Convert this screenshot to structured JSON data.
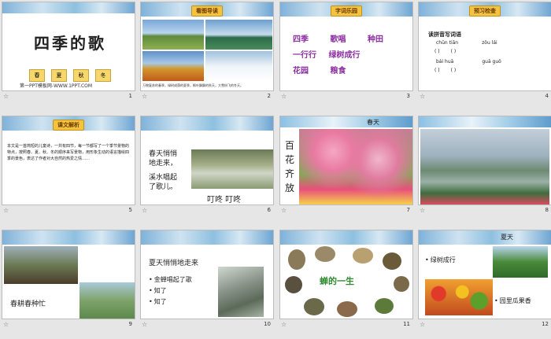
{
  "slides": [
    {
      "num": "1",
      "title": "四季的歌",
      "badges": [
        "春",
        "夏",
        "秋",
        "冬"
      ],
      "footer": "第一PPT模板网-WWW.1PPT.COM"
    },
    {
      "num": "2",
      "tag": "看图导读",
      "caption": "万物复苏的春季，绿树成荫的夏季，枫叶飘飘的秋天，大雪纷飞的冬天。"
    },
    {
      "num": "3",
      "tag": "字词乐园",
      "words": [
        [
          "四季",
          "歌唱",
          "种田"
        ],
        [
          "一行行",
          "绿树成行"
        ],
        [
          "花园",
          "粮食"
        ]
      ]
    },
    {
      "num": "4",
      "tag": "预习检查",
      "instruction": "读拼音写词语",
      "pinyin": [
        [
          "chūn tiān",
          "zǒu lái"
        ],
        [
          "bái huā",
          "guā guǒ"
        ]
      ],
      "blanks": [
        "(          )",
        "(          )"
      ]
    },
    {
      "num": "5",
      "tag": "课文解析",
      "body": "本文是一首简短的儿童诗，一共有四节，每一节都写了一个季节景物的特点，按照春、夏、秋、冬的顺序来写景物，用形象生动的语言描绘四季的景色，表达了作者对大自然的热爱之情……"
    },
    {
      "num": "6",
      "lines": [
        "春天悄悄",
        "地走来，",
        "溪水唱起",
        "了歌儿。"
      ],
      "onomatopoeia": "叮咚 叮咚"
    },
    {
      "num": "7",
      "title": "春天",
      "vertical": [
        "百",
        "花",
        "齐",
        "放"
      ]
    },
    {
      "num": "8"
    },
    {
      "num": "9",
      "caption": "春耕春种忙"
    },
    {
      "num": "10",
      "heading": "夏天悄悄地走来",
      "bullets": [
        "金蝉唱起了歌",
        "知了",
        "知了"
      ]
    },
    {
      "num": "11",
      "center": "蝉的一生"
    },
    {
      "num": "12",
      "title": "夏天",
      "bullets": [
        "绿树成行",
        "园里瓜果香"
      ]
    }
  ],
  "star_icon": "☆"
}
